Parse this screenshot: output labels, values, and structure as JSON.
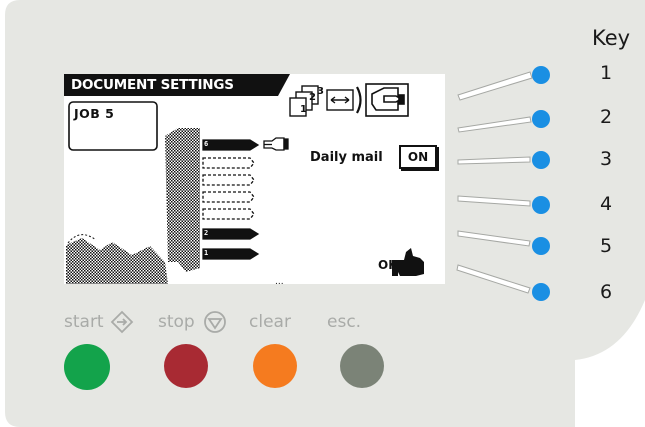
{
  "display": {
    "title": "DOCUMENT SETTINGS",
    "job_label": "JOB  5",
    "daily_mail_label": "Daily mail",
    "daily_mail_value": "ON",
    "ok_label": "OK",
    "station_numbers": [
      "6",
      "2",
      "1"
    ]
  },
  "labels": {
    "start": "start",
    "stop": "stop",
    "clear": "clear",
    "esc": "esc."
  },
  "key": {
    "title": "Key",
    "numbers": [
      "1",
      "2",
      "3",
      "4",
      "5",
      "6"
    ]
  },
  "colors": {
    "panel": "#e6e7e3",
    "lcd_outline": "#1a1a1a",
    "key_led": "#1a8fe3",
    "start": "#13a34b",
    "stop": "#a82a33",
    "clear": "#f57b1f",
    "esc": "#7b8377",
    "label_gray": "#a9aba8"
  },
  "icons": {
    "start": "diamond-arrow-icon",
    "stop": "circle-down-arrow-icon",
    "hand_point": "pointing-hand-icon",
    "hand_ok": "thumbs-up-hand-icon"
  }
}
